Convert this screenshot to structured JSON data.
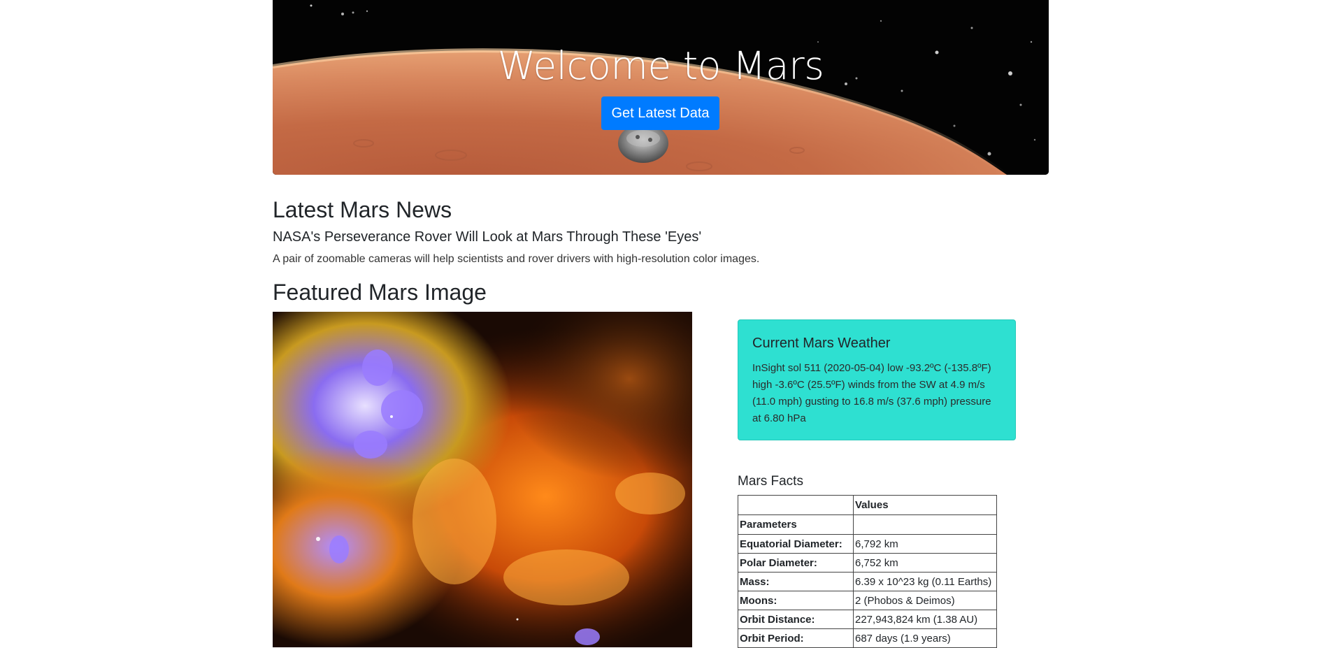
{
  "hero": {
    "title": "Welcome to Mars",
    "button_label": "Get Latest Data"
  },
  "news": {
    "heading": "Latest Mars News",
    "title": "NASA's Perseverance Rover Will Look at Mars Through These 'Eyes'",
    "teaser": "A pair of zoomable cameras will help scientists and rover drivers with high-resolution color images."
  },
  "featured": {
    "heading": "Featured Mars Image"
  },
  "weather": {
    "title": "Current Mars Weather",
    "text": "InSight sol 511 (2020-05-04) low -93.2ºC (-135.8ºF) high -3.6ºC (25.5ºF) winds from the SW at 4.9 m/s (11.0 mph) gusting to 16.8 m/s (37.6 mph) pressure at 6.80 hPa"
  },
  "facts": {
    "heading": "Mars Facts",
    "col_blank": "",
    "col_values": "Values",
    "index_label": "Parameters",
    "rows": [
      {
        "param": "Equatorial Diameter:",
        "value": "6,792 km"
      },
      {
        "param": "Polar Diameter:",
        "value": "6,752 km"
      },
      {
        "param": "Mass:",
        "value": "6.39 x 10^23 kg (0.11 Earths)"
      },
      {
        "param": "Moons:",
        "value": "2 (Phobos & Deimos)"
      },
      {
        "param": "Orbit Distance:",
        "value": "227,943,824 km (1.38 AU)"
      },
      {
        "param": "Orbit Period:",
        "value": "687 days (1.9 years)"
      }
    ]
  },
  "colors": {
    "primary_button": "#007bff",
    "weather_card": "#2ee0d1"
  }
}
